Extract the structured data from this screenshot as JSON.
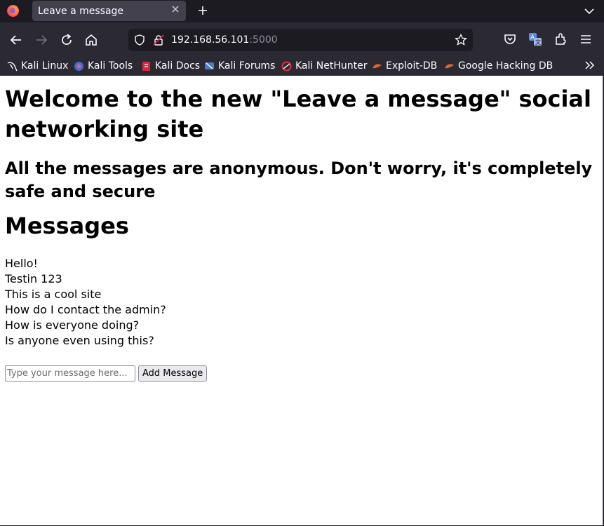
{
  "browser": {
    "tab_title": "Leave a message",
    "url_host": "192.168.56.101",
    "url_port": ":5000",
    "icons": [
      "firefox-logo",
      "close-icon",
      "plus-icon",
      "chevron-down-icon",
      "back-icon",
      "forward-icon",
      "reload-icon",
      "home-icon",
      "shield-icon",
      "lock-icon",
      "star-icon",
      "pocket-icon",
      "translate-icon",
      "extensions-icon",
      "menu-icon",
      "chevron-double-right-icon"
    ]
  },
  "bookmarks": [
    {
      "label": "Kali Linux",
      "icon": "kali-dragon-icon"
    },
    {
      "label": "Kali Tools",
      "icon": "kali-tools-icon"
    },
    {
      "label": "Kali Docs",
      "icon": "kali-docs-icon"
    },
    {
      "label": "Kali Forums",
      "icon": "kali-forums-icon"
    },
    {
      "label": "Kali NetHunter",
      "icon": "nethunter-icon"
    },
    {
      "label": "Exploit-DB",
      "icon": "exploit-db-icon"
    },
    {
      "label": "Google Hacking DB",
      "icon": "ghdb-icon"
    }
  ],
  "page": {
    "heading": "Welcome to the new \"Leave a message\" social networking site",
    "subheading": "All the messages are anonymous. Don't worry, it's completely safe and secure",
    "messages_heading": "Messages",
    "messages": [
      "Hello!",
      "Testin 123",
      "This is a cool site",
      "How do I contact the admin?",
      "How is everyone doing?",
      "Is anyone even using this?"
    ],
    "input_placeholder": "Type your message here...",
    "input_value": "",
    "add_button_label": "Add Message"
  },
  "colors": {
    "tabstrip_bg": "#1c1b22",
    "toolbar_bg": "#2b2a33",
    "active_tab_bg": "#42414d",
    "page_bg": "#ffffff"
  }
}
